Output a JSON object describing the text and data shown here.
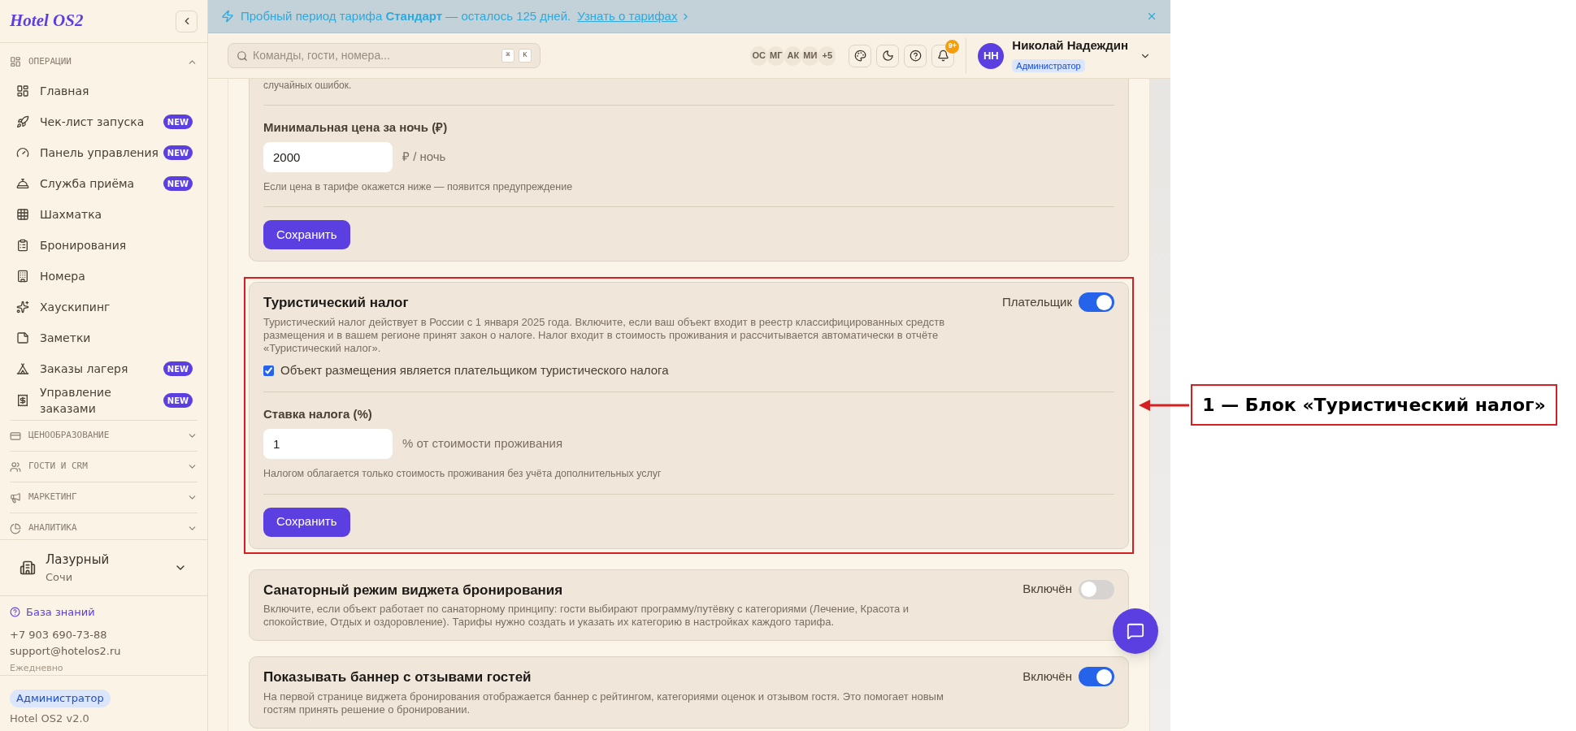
{
  "banner": {
    "text": "Пробный период тарифа **Стандарт** — осталось 125 дней.",
    "link": "Узнать о тарифах"
  },
  "sidebar": {
    "logo": "Hotel OS2",
    "sections": [
      {
        "title": "ОПЕРАЦИИ",
        "expanded": true,
        "items": [
          {
            "label": "Главная"
          },
          {
            "label": "Чек-лист запуска",
            "badge": "NEW"
          },
          {
            "label": "Панель управления",
            "badge": "NEW"
          },
          {
            "label": "Служба приёма",
            "badge": "NEW"
          },
          {
            "label": "Шахматка"
          },
          {
            "label": "Бронирования"
          },
          {
            "label": "Номера"
          },
          {
            "label": "Хаускипинг"
          },
          {
            "label": "Заметки"
          },
          {
            "label": "Заказы лагеря",
            "badge": "NEW"
          },
          {
            "label": "Управление заказами",
            "badge": "NEW"
          }
        ]
      },
      {
        "title": "ЦЕНООБРАЗОВАНИЕ",
        "expanded": false
      },
      {
        "title": "ГОСТИ И CRM",
        "expanded": false
      },
      {
        "title": "МАРКЕТИНГ",
        "expanded": false
      },
      {
        "title": "АНАЛИТИКА",
        "expanded": false
      }
    ],
    "property": {
      "name": "Лазурный",
      "city": "Сочи"
    },
    "support": {
      "link": "База знаний",
      "phone": "+7 903 690-73-88",
      "email": "support@hotelos2.ru",
      "hours": "Ежедневно"
    },
    "role": "Администратор",
    "version": "Hotel OS2 v2.0"
  },
  "topbar": {
    "search": {
      "placeholder": "Команды, гости, номера...",
      "keys": [
        "⌘",
        "K"
      ]
    },
    "avatars": [
      "ОС",
      "МГ",
      "АК",
      "МИ",
      "+5"
    ],
    "notifications": "9+",
    "user": {
      "initials": "НН",
      "name": "Николай Надеждин",
      "role": "Администратор"
    }
  },
  "cards": [
    {
      "kind": "form",
      "highlighted": false,
      "note": "случайных ошибок.",
      "field": {
        "label": "Минимальная цена за ночь (₽)",
        "value": "2000",
        "unit": "₽ / ночь",
        "hint": "Если цена в тарифе окажется ниже — появится предупреждение"
      },
      "button": "Сохранить"
    },
    {
      "kind": "form",
      "highlighted": true,
      "title": "Туристический налог",
      "description": "Туристический налог действует в России с 1 января 2025 года. Включите, если ваш объект входит в реестр классифицированных средств размещения и в вашем регионе принят закон о налоге. Налог входит в стоимость проживания и рассчитывается автоматически в отчёте «Туристический налог».",
      "toggle": {
        "label": "Плательщик",
        "on": true
      },
      "checkbox": {
        "label": "Объект размещения является плательщиком туристического налога",
        "checked": true
      },
      "field": {
        "label": "Ставка налога (%)",
        "value": "1",
        "unit": "% от стоимости проживания",
        "hint": "Налогом облагается только стоимость проживания без учёта дополнительных услуг"
      },
      "button": "Сохранить"
    },
    {
      "kind": "toggle",
      "highlighted": false,
      "title": "Санаторный режим виджета бронирования",
      "description": "Включите, если объект работает по санаторному принципу: гости выбирают программу/путёвку с категориями (Лечение, Красота и спокойствие, Отдых и оздоровление). Тарифы нужно создать и указать их категорию в настройках каждого тарифа.",
      "toggle": {
        "label": "Включён",
        "on": false
      }
    },
    {
      "kind": "toggle",
      "highlighted": false,
      "title": "Показывать баннер с отзывами гостей",
      "description": "На первой странице виджета бронирования отображается баннер с рейтингом, категориями оценок и отзывом гостя. Это помогает новым гостям принять решение о бронировании.",
      "toggle": {
        "label": "Включён",
        "on": true
      }
    }
  ],
  "annotation": {
    "label": "1 — Блок «Туристический налог»"
  }
}
